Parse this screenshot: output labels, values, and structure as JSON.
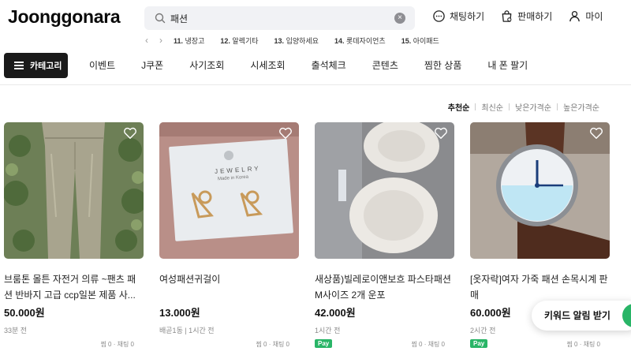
{
  "header": {
    "logo": "Joonggonara",
    "search": {
      "value": "패션"
    },
    "actions": [
      {
        "label": "채팅하기",
        "icon": "chat-icon"
      },
      {
        "label": "판매하기",
        "icon": "sell-bag-icon"
      },
      {
        "label": "마이",
        "icon": "user-icon"
      }
    ]
  },
  "ranking": [
    {
      "num": "11.",
      "label": "냉장고"
    },
    {
      "num": "12.",
      "label": "알렉기타"
    },
    {
      "num": "13.",
      "label": "입양하세요"
    },
    {
      "num": "14.",
      "label": "롯데자이언츠"
    },
    {
      "num": "15.",
      "label": "아이패드"
    }
  ],
  "category_button": "카테고리",
  "nav": [
    "이벤트",
    "J쿠폰",
    "사기조회",
    "시세조회",
    "출석체크",
    "콘텐츠",
    "찜한 상품",
    "내 폰 팔기"
  ],
  "sort": {
    "options": [
      "추천순",
      "최신순",
      "낮은가격순",
      "높은가격순"
    ],
    "active": "추천순"
  },
  "products": [
    {
      "title": "브룸톤 몰튼 자전거 의류 ~팬츠 패션 반바지 고급 ccp일본 제품 사...",
      "price": "50.000원",
      "meta": "33분 전",
      "pay": "",
      "stats": "찜 0 · 채팅 0"
    },
    {
      "title": "여성패션귀걸이",
      "price": "13.000원",
      "meta": "배곧1동 | 1시간 전",
      "pay": "",
      "stats": "찜 0 · 채팅 0",
      "thumb_text": "JEWELRY",
      "thumb_sub": "Made in Korea"
    },
    {
      "title": "새상품)빌레로이앤보흐 파스타패션 M사이즈 2개 운포",
      "price": "42.000원",
      "meta": "1시간 전",
      "pay": "Pay",
      "stats": "찜 0 · 채팅 0"
    },
    {
      "title": "[옷자락]여자 가죽 패션 손목시계 판매",
      "price": "60.000원",
      "meta": "2시간 전",
      "pay": "Pay",
      "stats": "찜 0 · 채팅 0"
    }
  ],
  "toast": {
    "label": "키워드 알림 받기"
  },
  "colors": {
    "accent": "#29b567",
    "dark": "#1a1a1a"
  }
}
